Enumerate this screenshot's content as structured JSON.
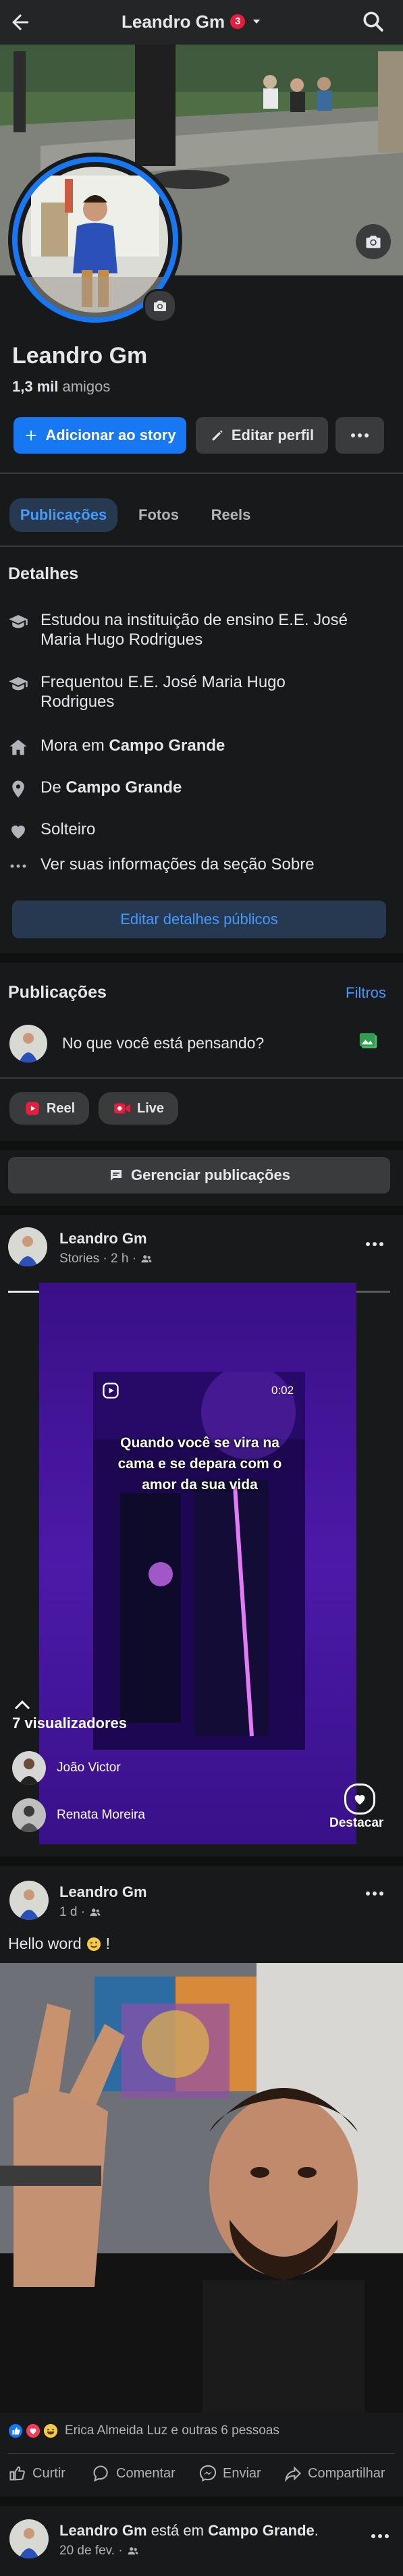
{
  "header": {
    "title": "Leandro Gm",
    "notification_count": "3"
  },
  "profile": {
    "name": "Leandro Gm",
    "friends_count": "1,3 mil",
    "friends_label": "amigos",
    "add_story_label": "Adicionar ao story",
    "edit_profile_label": "Editar perfil"
  },
  "tabs": [
    {
      "label": "Publicações",
      "active": true
    },
    {
      "label": "Fotos",
      "active": false
    },
    {
      "label": "Reels",
      "active": false
    }
  ],
  "details": {
    "heading": "Detalhes",
    "items": [
      {
        "icon": "graduation-cap-icon",
        "text": "Estudou na instituição de ensino E.E. José Maria Hugo Rodrigues"
      },
      {
        "icon": "graduation-cap-icon",
        "text": "Frequentou E.E. José Maria Hugo Rodrigues"
      },
      {
        "icon": "house-icon",
        "prefix": "Mora em ",
        "highlight": "Campo Grande"
      },
      {
        "icon": "location-pin-icon",
        "prefix": "De ",
        "highlight": "Campo Grande"
      },
      {
        "icon": "heart-icon",
        "text": "Solteiro"
      },
      {
        "icon": "more-dots-icon",
        "text": "Ver suas informações da seção Sobre"
      }
    ],
    "edit_button_label": "Editar detalhes públicos"
  },
  "posts_section": {
    "heading": "Publicações",
    "filters_label": "Filtros",
    "composer_placeholder": "No que você está pensando?",
    "reel_label": "Reel",
    "live_label": "Live",
    "manage_label": "Gerenciar publicações"
  },
  "story_post": {
    "author": "Leandro Gm",
    "meta": "Stories · 2 h ·",
    "story_time": "0:02",
    "story_caption": "Quando você se vira na cama e se depara com o amor da sua vida",
    "viewers_label": "7 visualizadores",
    "viewers": [
      "João Victor",
      "Renata Moreira"
    ],
    "highlight_label": "Destacar"
  },
  "photo_post": {
    "author": "Leandro Gm",
    "meta": "1 d ·",
    "text": "Hello word",
    "reactions_text": "Erica Almeida Luz e outras 6 pessoas",
    "actions": [
      "Curtir",
      "Comentar",
      "Enviar",
      "Compartilhar"
    ]
  },
  "next_post": {
    "author": "Leandro Gm",
    "mid_text": " está em ",
    "place": "Campo Grande",
    "end": ".",
    "meta": "20 de fev. ·"
  },
  "colors": {
    "background": "#18191a",
    "card": "#242526",
    "accent": "#1877f2",
    "link": "#4599ff",
    "notification": "#e41e3f"
  }
}
